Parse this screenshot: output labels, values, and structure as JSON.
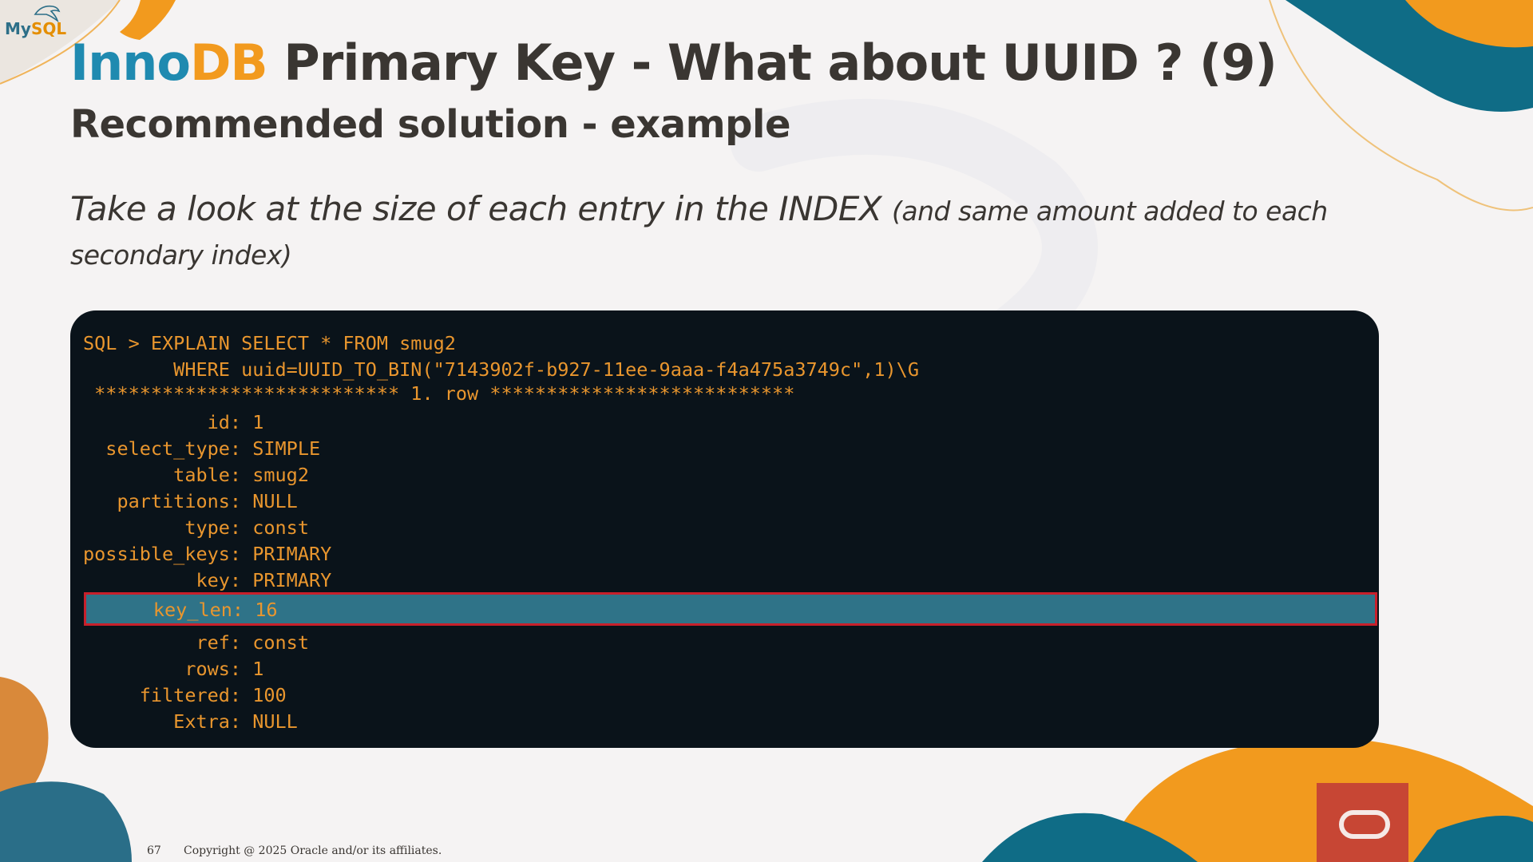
{
  "logo": {
    "part1": "My",
    "part2": "SQL"
  },
  "title": {
    "inno": "Inno",
    "db": "DB",
    "rest": " Primary Key - What about UUID ? (9)"
  },
  "subtitle": "Recommended solution - example",
  "lead": {
    "main": "Take a look at the size of each entry in the INDEX ",
    "note": "(and same amount added to each secondary index)"
  },
  "terminal": {
    "lines": [
      "SQL > EXPLAIN SELECT * FROM smug2",
      "        WHERE uuid=UUID_TO_BIN(\"7143902f-b927-11ee-9aaa-f4a475a3749c\",1)\\G",
      " *************************** 1. row ***************************",
      "           id: 1",
      "  select_type: SIMPLE",
      "        table: smug2",
      "   partitions: NULL",
      "         type: const",
      "possible_keys: PRIMARY",
      "          key: PRIMARY",
      "      key_len: 16",
      "          ref: const",
      "         rows: 1",
      "     filtered: 100",
      "        Extra: NULL"
    ],
    "highlighted_line": "key_len: 16"
  },
  "footer": {
    "page_number": "67",
    "copyright": "Copyright @ 2025 Oracle and/or its affiliates."
  },
  "colors": {
    "background": "#f5f3f3",
    "terminal_bg": "#0a131a",
    "terminal_text": "#e9962e",
    "highlight_bg": "#2f7388",
    "highlight_border": "#c8202b",
    "teal": "#0f6c86",
    "orange": "#f29a1e",
    "oracle_red": "#c74634"
  }
}
